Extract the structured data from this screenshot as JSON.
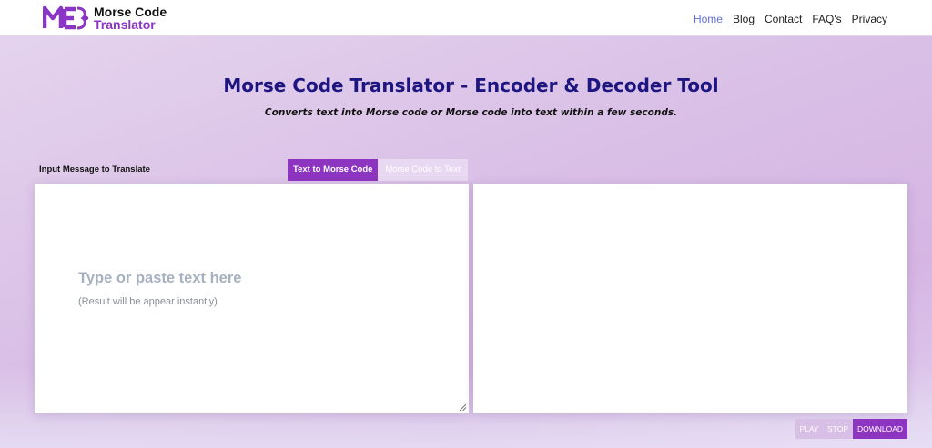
{
  "brand": {
    "line1": "Morse Code",
    "line2": "Translator",
    "accent": "#8a35c6"
  },
  "nav": {
    "items": [
      {
        "label": "Home",
        "active": true
      },
      {
        "label": "Blog",
        "active": false
      },
      {
        "label": "Contact",
        "active": false
      },
      {
        "label": "FAQ's",
        "active": false
      },
      {
        "label": "Privacy",
        "active": false
      }
    ]
  },
  "hero": {
    "title": "Morse Code Translator - Encoder & Decoder Tool",
    "subtitle": "Converts text into Morse code or Morse code into text within a few seconds."
  },
  "translator": {
    "input_label": "Input Message to Translate",
    "tabs": [
      {
        "label": "Text to Morse Code",
        "active": true
      },
      {
        "label": "Morse Code to Text",
        "active": false
      }
    ],
    "input": {
      "value": "",
      "placeholder_main": "Type or paste text here",
      "placeholder_sub": "(Result will be appear instantly)"
    },
    "output": {
      "value": ""
    },
    "controls": {
      "play_label": "PLAY",
      "stop_label": "STOP",
      "download_label": "DOWNLOAD"
    }
  },
  "colors": {
    "title": "#1d1580",
    "active_tab": "#8d35c0",
    "nav_active": "#6270d8"
  }
}
